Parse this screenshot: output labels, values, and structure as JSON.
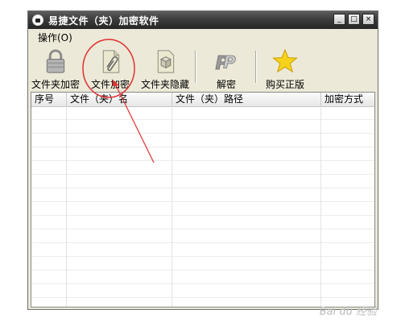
{
  "window": {
    "title": "易捷文件（夹）加密软件",
    "controls": {
      "minimize": "_",
      "maximize": "□",
      "close": "×"
    }
  },
  "menu": {
    "items": [
      {
        "label": "操作(O)"
      }
    ]
  },
  "toolbar": {
    "buttons": [
      {
        "label": "文件夹加密",
        "icon": "padlock-icon"
      },
      {
        "label": "文件加密",
        "icon": "paperclip-document-icon"
      },
      {
        "label": "文件夹隐藏",
        "icon": "cube-icon"
      },
      {
        "label": "解密",
        "icon": "pp-decrypt-icon"
      },
      {
        "label": "购买正版",
        "icon": "star-icon"
      }
    ]
  },
  "table": {
    "columns": [
      "序号",
      "文件（夹）名",
      "文件（夹）路径",
      "加密方式"
    ],
    "rows": []
  },
  "annotation": {
    "circle_color": "#e03030",
    "arrow_color": "#e03030"
  },
  "watermark": "Bai du 经验"
}
